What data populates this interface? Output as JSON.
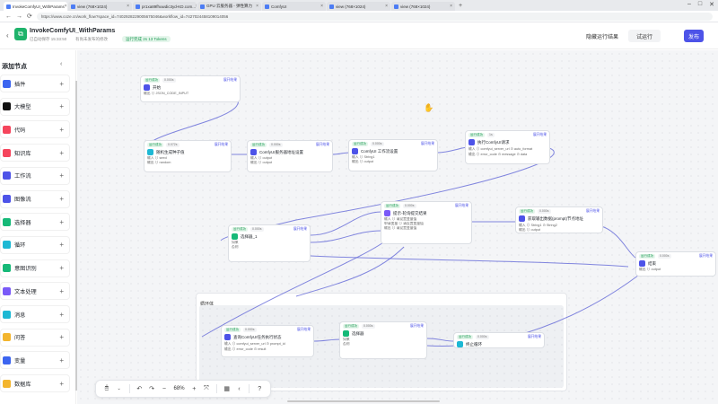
{
  "browser": {
    "tabs": [
      {
        "title": "InvokeComfyUI_WithParams",
        "active": true
      },
      {
        "title": "view (768×1024)",
        "active": false
      },
      {
        "title": "pr1xa89fhuwdic3yd-KD.com...",
        "active": false
      },
      {
        "title": "GPU 云服务器 - 弹性算力",
        "active": false
      },
      {
        "title": "ComfyUI",
        "active": false
      },
      {
        "title": "view (768×1024)",
        "active": false
      },
      {
        "title": "view (768×1024)",
        "active": false
      }
    ],
    "new_tab": "+",
    "url": "https://www.coze.cn/work_flow?space_id=7402928229005675046&workflow_id=7427024458109014056"
  },
  "app": {
    "title": "InvokeComfyUI_WithParams",
    "saved": "已自动保存 15:33:50",
    "unpublished": "有尚未发布的修改",
    "run_status": "运行完成 2s  13 Tokens",
    "hide_result": "隐藏运行结果",
    "test_run": "试运行",
    "publish": "发布"
  },
  "sidebar": {
    "title": "添加节点",
    "collapse": "‹",
    "items": [
      {
        "label": "插件",
        "color": "#3c65f0"
      },
      {
        "label": "大模型",
        "color": "#111111"
      },
      {
        "label": "代码",
        "color": "#f5455c"
      },
      {
        "label": "知识库",
        "color": "#f5455c"
      },
      {
        "label": "工作流",
        "color": "#4d53e8"
      },
      {
        "label": "图像流",
        "color": "#4d53e8"
      },
      {
        "label": "选择器",
        "color": "#16b978"
      },
      {
        "label": "循环",
        "color": "#1db8d4"
      },
      {
        "label": "意图识别",
        "color": "#16b978"
      },
      {
        "label": "文本处理",
        "color": "#7a5af8"
      },
      {
        "label": "消息",
        "color": "#1db8d4"
      },
      {
        "label": "问答",
        "color": "#f3b52e"
      },
      {
        "label": "变量",
        "color": "#3c65f0"
      },
      {
        "label": "数据库",
        "color": "#f3b52e"
      }
    ]
  },
  "nodes": [
    {
      "badge": "运行成功",
      "time": "0.000s",
      "result": "展开结果",
      "title": "开始",
      "icon_color": "#4d53e8",
      "rows": [
        "输出  ⊙ JSON_CODE_INPUT"
      ]
    },
    {
      "badge": "运行成功",
      "time": "0.072s",
      "result": "展开结果",
      "title": "随机生成种子值",
      "icon_color": "#1db8d4",
      "rows": [
        "输入  ⊙ seed",
        "输出  ⊙ random"
      ]
    },
    {
      "badge": "运行成功",
      "time": "0.000s",
      "result": "展开结果",
      "title": "ComfyUI服务器地址设置",
      "icon_color": "#4d53e8",
      "rows": [
        "输入  ⊙ output",
        "输出  ⊙ output"
      ]
    },
    {
      "badge": "运行成功",
      "time": "0.000s",
      "result": "展开结果",
      "title": "ComfyUI 工作流设置",
      "icon_color": "#4d53e8",
      "rows": [
        "输入  ⊙ String1",
        "输出  ⊙ output"
      ]
    },
    {
      "badge": "运行成功",
      "time": "1s",
      "result": "展开结果",
      "title": "执行ComfyUI请求",
      "icon_color": "#4d53e8",
      "rows": [
        "输入  ⊙ comfyui_server_url  ⊙ auto_format",
        "输出  ⊙ error_code  ⊙ message  ⊙ data"
      ]
    },
    {
      "badge": "运行成功",
      "time": "0.000s",
      "result": "展开结果",
      "title": "选择器_1",
      "icon_color": "#16b978",
      "rows": [
        "如果",
        "否则"
      ]
    },
    {
      "badge": "运行成功",
      "time": "0.000s",
      "result": "展开结果",
      "title": "提示-轮询提交结果",
      "icon_color": "#7a5af8",
      "rows": [
        "输入  ⊙ 请设置变量值",
        "申请变量  ⊙ 请设置变量值",
        "输出  ⊙ 请设置变量值"
      ]
    },
    {
      "badge": "运行成功",
      "time": "0.000s",
      "result": "展开结果",
      "title": "获取输出数据(prompt)节点地址",
      "icon_color": "#4d53e8",
      "rows": [
        "输入  ⊙ String1  ⊙ String2",
        "输出  ⊙ output"
      ]
    },
    {
      "badge": "运行成功",
      "time": "0.000s",
      "result": "展开结果",
      "title": "结束",
      "icon_color": "#4d53e8",
      "rows": [
        "输出  ⊙ output"
      ]
    },
    {
      "badge": "运行成功",
      "time": "0.000s",
      "result": "展开结果",
      "title": "查询ComfyUI任务执行状态",
      "icon_color": "#4d53e8",
      "rows": [
        "输入  ⊙ comfyui_server_url  ⊙ prompt_id",
        "输出  ⊙ error_code  ⊙ result"
      ]
    },
    {
      "badge": "运行成功",
      "time": "0.000s",
      "result": "展开结果",
      "title": "选择器",
      "icon_color": "#16b978",
      "rows": [
        "如果",
        "否则"
      ]
    },
    {
      "badge": "运行成功",
      "time": "0.000s",
      "result": "展开结果",
      "title": "终止循环",
      "icon_color": "#1db8d4",
      "rows": []
    }
  ],
  "loop": {
    "title": "循环体"
  },
  "toolbar": {
    "zoom": "68%"
  }
}
